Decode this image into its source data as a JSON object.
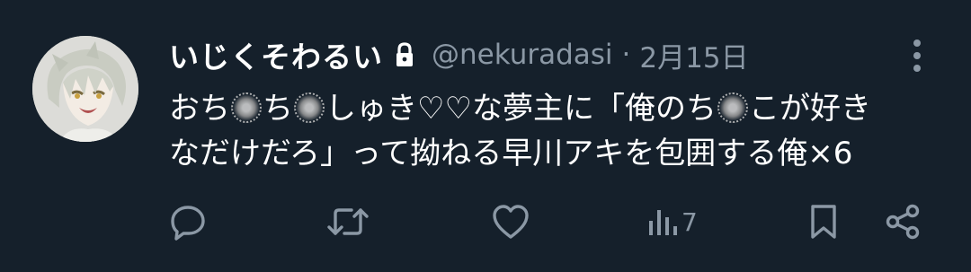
{
  "tweet": {
    "display_name": "いじくそわるい",
    "handle": "@nekuradasi",
    "separator": "·",
    "date": "2月15日",
    "text_segments": [
      "おち",
      "",
      "ち",
      "",
      "しゅき♡♡な夢主に「俺のち",
      "",
      "こが好き",
      "なだけだろ」って拗ねる早川アキを包囲する俺×6"
    ],
    "views_count": "7"
  },
  "colors": {
    "background": "#15202b",
    "text_primary": "#ffffff",
    "text_secondary": "#8b98a5"
  },
  "icons": {
    "lock": "lock-icon",
    "more": "more-vertical-icon",
    "reply": "reply-icon",
    "retweet": "retweet-icon",
    "like": "heart-icon",
    "views": "views-chart-icon",
    "bookmark": "bookmark-icon",
    "share": "share-icon"
  }
}
